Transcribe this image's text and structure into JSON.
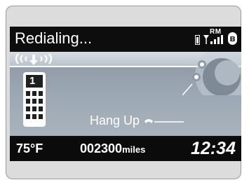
{
  "header": {
    "title": "Redialing...",
    "icons": [
      "battery-icon",
      "signal-icon",
      "bluetooth-icon"
    ],
    "roam_label": "RM"
  },
  "call": {
    "signal_waves": "(((↓)))",
    "speed_dial_slot": "1",
    "hangup_label": "Hang Up"
  },
  "footer": {
    "temperature": "75°F",
    "odometer": "002300",
    "odometer_unit": "miles",
    "clock": "12:34"
  },
  "colors": {
    "screen_bg": "#111111",
    "content_bg": "#9eaab5",
    "text": "#ffffff"
  }
}
